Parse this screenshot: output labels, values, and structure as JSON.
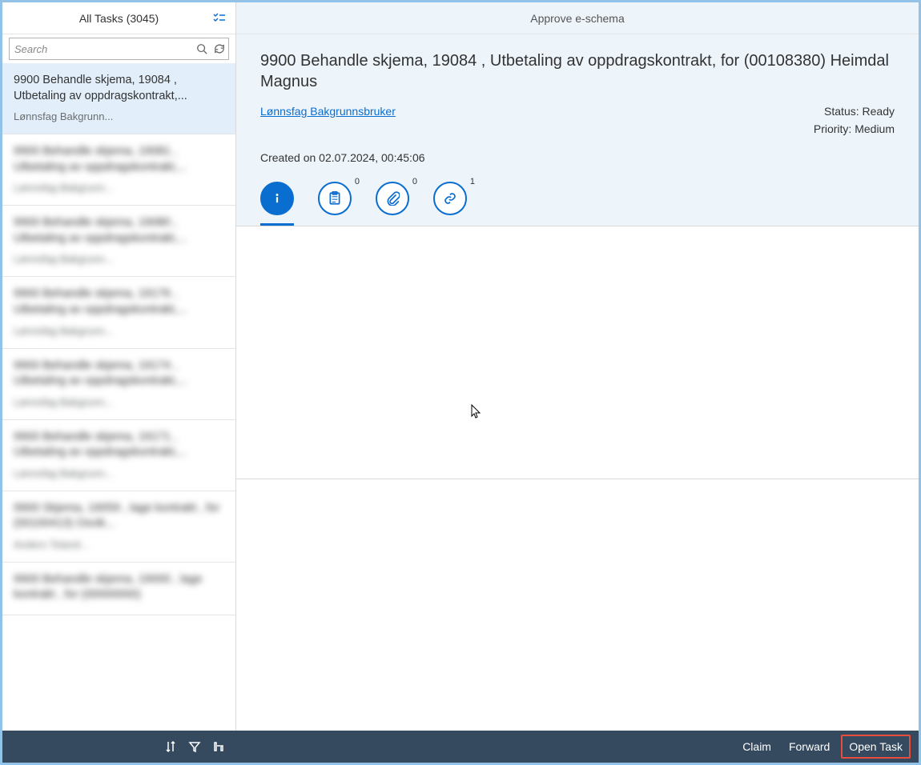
{
  "sidebar": {
    "title": "All Tasks (3045)",
    "search_placeholder": "Search",
    "items": [
      {
        "title": "9900 Behandle skjema, 19084 , Utbetaling av oppdragskontrakt,...",
        "sub": "Lønnsfag Bakgrunn...",
        "selected": true,
        "blurred": false
      },
      {
        "title": "9900 Behandle skjema, 19081 , Utbetaling av oppdragskontrakt,...",
        "sub": "Lønnsfag Bakgrunn...",
        "selected": false,
        "blurred": true
      },
      {
        "title": "9900 Behandle skjema, 19080 , Utbetaling av oppdragskontrakt,...",
        "sub": "Lønnsfag Bakgrunn...",
        "selected": false,
        "blurred": true
      },
      {
        "title": "9900 Behandle skjema, 19176 , Utbetaling av oppdragskontrakt,...",
        "sub": "Lønnsfag Bakgrunn...",
        "selected": false,
        "blurred": true
      },
      {
        "title": "9900 Behandle skjema, 19174 , Utbetaling av oppdragskontrakt,...",
        "sub": "Lønnsfag Bakgrunn...",
        "selected": false,
        "blurred": true
      },
      {
        "title": "9900 Behandle skjema, 19171 , Utbetaling av oppdragskontrakt,...",
        "sub": "Lønnsfag Bakgrunn...",
        "selected": false,
        "blurred": true
      },
      {
        "title": "9900 Skjema, 19059 , lage kontrakt , for (00100413) Osvik...",
        "sub": "Anders Toland...",
        "selected": false,
        "blurred": true
      },
      {
        "title": "9900 Behandle skjema, 19000 , lage kontrakt , for (00000000)",
        "sub": "",
        "selected": false,
        "blurred": true
      }
    ]
  },
  "content": {
    "header": "Approve e-schema",
    "title": "9900 Behandle skjema, 19084 , Utbetaling av oppdragskontrakt, for (00108380) Heimdal Magnus",
    "author": "Lønnsfag Bakgrunnsbruker",
    "status_label": "Status:",
    "status_value": "Ready",
    "priority_label": "Priority:",
    "priority_value": "Medium",
    "created_label": "Created on",
    "created_value": "02.07.2024, 00:45:06",
    "tabs": {
      "notes_badge": "0",
      "attachments_badge": "0",
      "links_badge": "1"
    }
  },
  "footer": {
    "claim": "Claim",
    "forward": "Forward",
    "open_task": "Open Task"
  }
}
